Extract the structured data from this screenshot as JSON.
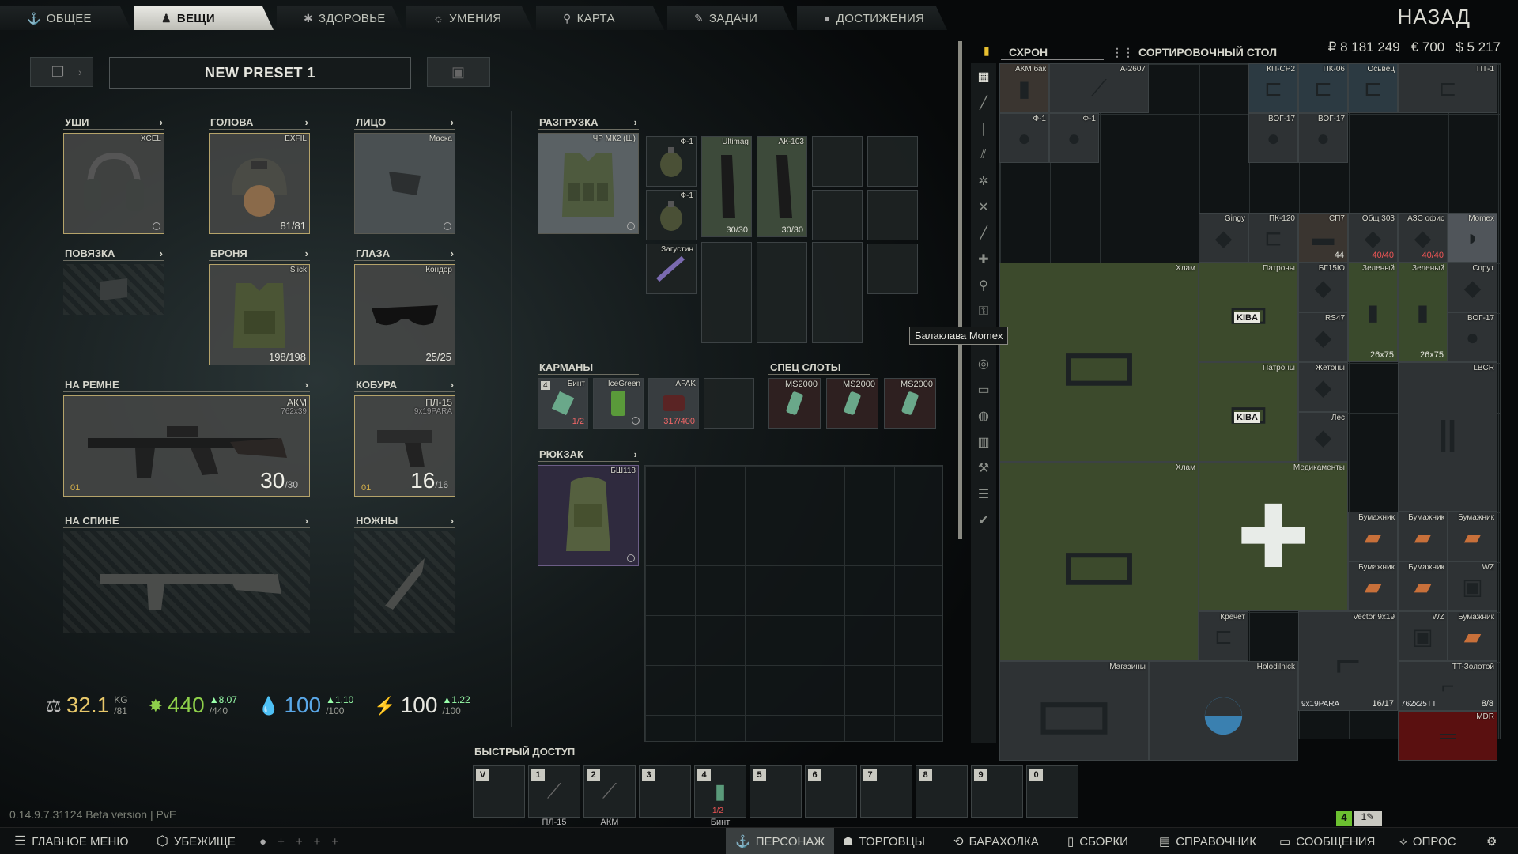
{
  "nav": {
    "tabs": [
      {
        "label": "ОБЩЕЕ",
        "icon": "anchor-icon"
      },
      {
        "label": "ВЕЩИ",
        "icon": "doll-icon"
      },
      {
        "label": "ЗДОРОВЬЕ",
        "icon": "health-icon"
      },
      {
        "label": "УМЕНИЯ",
        "icon": "skills-icon"
      },
      {
        "label": "КАРТА",
        "icon": "map-pin-icon"
      },
      {
        "label": "ЗАДАЧИ",
        "icon": "tasks-icon"
      },
      {
        "label": "ДОСТИЖЕНИЯ",
        "icon": "achievement-icon"
      }
    ],
    "active_tab": "ВЕЩИ",
    "back": "НАЗАД"
  },
  "preset": {
    "name": "NEW PRESET 1"
  },
  "slots": {
    "ears": {
      "header": "УШИ",
      "item": "XCEL"
    },
    "head": {
      "header": "ГОЛОВА",
      "item": "EXFIL",
      "durability": "81/81"
    },
    "face": {
      "header": "ЛИЦО",
      "item": "Маска"
    },
    "armband": {
      "header": "ПОВЯЗКА"
    },
    "armor": {
      "header": "БРОНЯ",
      "item": "Slick",
      "durability": "198/198"
    },
    "eyes": {
      "header": "ГЛАЗА",
      "item": "Кондор",
      "durability": "25/25"
    },
    "belt": {
      "header": "НА РЕМНЕ",
      "item": "АКМ",
      "caliber": "762x39",
      "ammo": "30",
      "ammo_max": "/30",
      "mastery": "01"
    },
    "holster": {
      "header": "КОБУРА",
      "item": "ПЛ-15",
      "caliber": "9x19PARA",
      "ammo": "16",
      "ammo_max": "/16",
      "mastery": "01"
    },
    "back": {
      "header": "НА СПИНЕ"
    },
    "melee": {
      "header": "НОЖНЫ"
    },
    "rig": {
      "header": "РАЗГРУЗКА",
      "item": "ЧР МК2 (Ш)"
    },
    "pockets": {
      "header": "КАРМАНЫ"
    },
    "special": {
      "header": "СПЕЦ СЛОТЫ"
    },
    "backpack": {
      "header": "РЮКЗАК",
      "item": "БШ118"
    }
  },
  "rig_items": [
    {
      "name": "Ф-1"
    },
    {
      "name": "Ultimag",
      "count": "30/30"
    },
    {
      "name": "АК-103",
      "count": "30/30"
    },
    {
      "name": "Ф-1"
    },
    {
      "name": "Загустин"
    }
  ],
  "pockets": [
    {
      "name": "Бинт",
      "badge": "4",
      "count": "1/2"
    },
    {
      "name": "IceGreen"
    },
    {
      "name": "AFAK",
      "count": "317/400"
    }
  ],
  "special_slots": [
    "MS2000",
    "MS2000",
    "MS2000"
  ],
  "stats": {
    "weight": "32.1",
    "weight_unit": "KG",
    "weight_max": "/81",
    "energy": "440",
    "energy_max": "/440",
    "energy_delta": "▲8.07",
    "hydration": "100",
    "hydration_max": "/100",
    "hydration_delta": "▲1.10",
    "stamina": "100",
    "stamina_max": "/100",
    "stamina_delta": "▲1.22"
  },
  "quickbar": {
    "title": "БЫСТРЫЙ ДОСТУП",
    "slots": [
      {
        "key": "V",
        "label": ""
      },
      {
        "key": "1",
        "label": "ПЛ-15"
      },
      {
        "key": "2",
        "label": "АКМ"
      },
      {
        "key": "3",
        "label": ""
      },
      {
        "key": "4",
        "label": "Бинт",
        "count": "1/2"
      },
      {
        "key": "5",
        "label": ""
      },
      {
        "key": "6",
        "label": ""
      },
      {
        "key": "7",
        "label": ""
      },
      {
        "key": "8",
        "label": ""
      },
      {
        "key": "9",
        "label": ""
      },
      {
        "key": "0",
        "label": ""
      }
    ]
  },
  "version": "0.14.9.7.31124 Beta version | PvE",
  "stash": {
    "tab_stash": "СХРОН",
    "tab_sort": "СОРТИРОВОЧНЫЙ СТОЛ",
    "money_rub": "₽ 8 181 249",
    "money_eur": "€ 700",
    "money_usd": "$ 5 217",
    "tooltip": "Балаклава Momex",
    "items": [
      {
        "name": "АКМ бак"
      },
      {
        "name": "А-2607"
      },
      {
        "name": "КП-СР2"
      },
      {
        "name": "ПК-06"
      },
      {
        "name": "Осьвец"
      },
      {
        "name": "ПТ-1"
      },
      {
        "name": "Ф-1"
      },
      {
        "name": "Ф-1"
      },
      {
        "name": "ВОГ-17"
      },
      {
        "name": "ВОГ-17"
      },
      {
        "name": "Gingy"
      },
      {
        "name": "ПК-120"
      },
      {
        "name": "СП7",
        "count": "44"
      },
      {
        "name": "Общ 303",
        "count": "40/40"
      },
      {
        "name": "АЗС офис",
        "count": "40/40"
      },
      {
        "name": "Momex"
      },
      {
        "name": "Хлам"
      },
      {
        "name": "Патроны"
      },
      {
        "name": "БГ15Ю"
      },
      {
        "name": "Зеленый",
        "count": "26x75"
      },
      {
        "name": "Зеленый",
        "count": "26x75"
      },
      {
        "name": "Спрут"
      },
      {
        "name": "RS47"
      },
      {
        "name": "ВОГ-17"
      },
      {
        "name": "Патроны"
      },
      {
        "name": "Жетоны"
      },
      {
        "name": "LBCR"
      },
      {
        "name": "Лес"
      },
      {
        "name": "Хлам"
      },
      {
        "name": "Медикаменты"
      },
      {
        "name": "Бумажник"
      },
      {
        "name": "Бумажник"
      },
      {
        "name": "Бумажник"
      },
      {
        "name": "Бумажник"
      },
      {
        "name": "Бумажник"
      },
      {
        "name": "WZ"
      },
      {
        "name": "Кречет"
      },
      {
        "name": "Vector 9x19",
        "count": "16/17",
        "caliber": "9x19PARA"
      },
      {
        "name": "WZ"
      },
      {
        "name": "Бумажник"
      },
      {
        "name": "TT-Золотой",
        "count": "8/8",
        "caliber": "762x25TT"
      },
      {
        "name": "Магазины"
      },
      {
        "name": "Holodilnick"
      },
      {
        "name": "MDR"
      }
    ],
    "ammo_box_label": "KIBA"
  },
  "bottom": {
    "main_menu": "ГЛАВНОЕ МЕНЮ",
    "hideout": "УБЕЖИЩЕ",
    "character": "ПЕРСОНАЖ",
    "traders": "ТОРГОВЦЫ",
    "flea": "БАРАХОЛКА",
    "builds": "СБОРКИ",
    "handbook": "СПРАВОЧНИК",
    "messages": "СООБЩЕНИЯ",
    "survey": "ОПРОС",
    "counter": "4"
  }
}
